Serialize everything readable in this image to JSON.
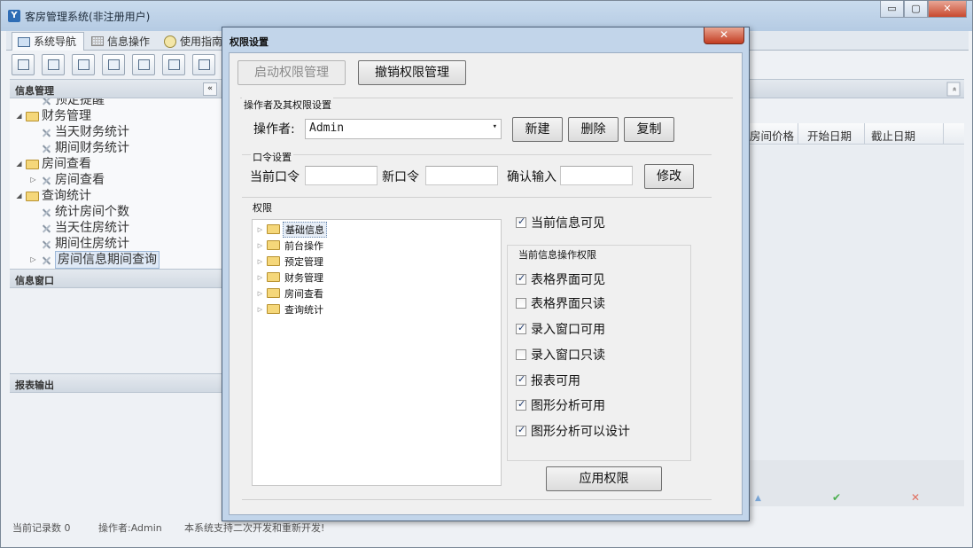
{
  "window": {
    "title": "客房管理系统(非注册用户)",
    "minimize": "▭",
    "maximize": "▢",
    "close": "✕"
  },
  "tabs": [
    {
      "label": "系统导航",
      "active": true
    },
    {
      "label": "信息操作",
      "active": false
    },
    {
      "label": "使用指南",
      "active": false
    }
  ],
  "left": {
    "info_mgmt": "信息管理",
    "collapse": "«",
    "tree": [
      {
        "label": "预定提醒",
        "level": 2
      },
      {
        "label": "财务管理",
        "level": 1
      },
      {
        "label": "当天财务统计",
        "level": 2
      },
      {
        "label": "期间财务统计",
        "level": 2
      },
      {
        "label": "房间查看",
        "level": 1
      },
      {
        "label": "房间查看",
        "level": 2
      },
      {
        "label": "查询统计",
        "level": 1
      },
      {
        "label": "统计房间个数",
        "level": 2
      },
      {
        "label": "当天住房统计",
        "level": 2
      },
      {
        "label": "期间住房统计",
        "level": 2
      },
      {
        "label": "房间信息期间查询",
        "level": 2
      }
    ],
    "info_window": "信息窗口",
    "report_output": "报表输出"
  },
  "right": {
    "collapse": "«",
    "columns": [
      "房间价格",
      "开始日期",
      "截止日期"
    ],
    "foot_icons": {
      "up": "▲",
      "ok": "✔",
      "cancel": "✕"
    }
  },
  "status": {
    "records": "当前记录数 0",
    "operator": "操作者:Admin",
    "note": "本系统支持二次开发和重新开发!"
  },
  "dialog": {
    "title": "权限设置",
    "close": "✕",
    "start_btn": "启动权限管理",
    "revoke_btn": "撤销权限管理",
    "operator_group": "操作者及其权限设置",
    "operator_label": "操作者:",
    "operator_value": "Admin",
    "combo_arrow": "▾",
    "new_btn": "新建",
    "delete_btn": "删除",
    "copy_btn": "复制",
    "password_group": "口令设置",
    "current_pwd": "当前口令",
    "new_pwd": "新口令",
    "confirm_pwd": "确认输入",
    "modify_btn": "修改",
    "perm_group": "权限",
    "perm_tree": [
      "基础信息",
      "前台操作",
      "预定管理",
      "财务管理",
      "房间查看",
      "查询统计"
    ],
    "visible_label": "当前信息可见",
    "visible_checked": true,
    "ops_group": "当前信息操作权限",
    "ops": [
      {
        "label": "表格界面可见",
        "checked": true
      },
      {
        "label": "表格界面只读",
        "checked": false
      },
      {
        "label": "录入窗口可用",
        "checked": true
      },
      {
        "label": "录入窗口只读",
        "checked": false
      },
      {
        "label": "报表可用",
        "checked": true
      },
      {
        "label": "图形分析可用",
        "checked": true
      },
      {
        "label": "图形分析可以设计",
        "checked": true
      }
    ],
    "apply_btn": "应用权限"
  }
}
